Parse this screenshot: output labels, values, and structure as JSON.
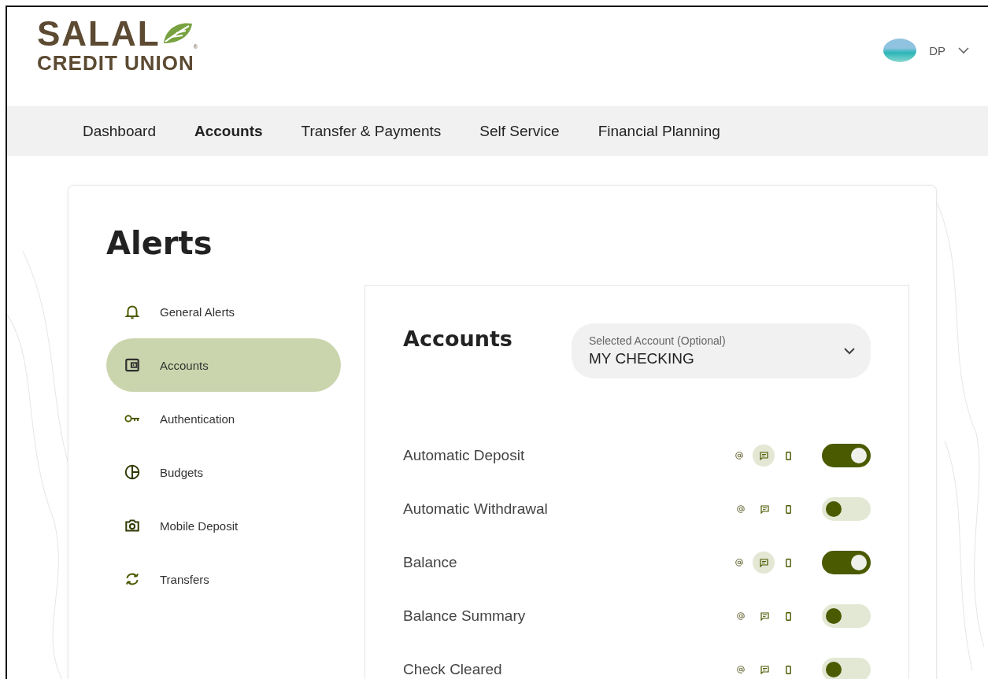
{
  "logo": {
    "name": "SALAL",
    "mark": "®",
    "subtitle": "CREDIT UNION"
  },
  "user": {
    "initials": "DP"
  },
  "nav": [
    {
      "label": "Dashboard",
      "selected": false
    },
    {
      "label": "Accounts",
      "selected": true
    },
    {
      "label": "Transfer & Payments",
      "selected": false
    },
    {
      "label": "Self Service",
      "selected": false
    },
    {
      "label": "Financial Planning",
      "selected": false
    }
  ],
  "page_title": "Alerts",
  "sidebar": {
    "items": [
      {
        "label": "General Alerts",
        "kind": "bell",
        "selected": false
      },
      {
        "label": "Accounts",
        "kind": "wallet",
        "selected": true
      },
      {
        "label": "Authentication",
        "kind": "key",
        "selected": false
      },
      {
        "label": "Budgets",
        "kind": "pie",
        "selected": false
      },
      {
        "label": "Mobile Deposit",
        "kind": "camera",
        "selected": false
      },
      {
        "label": "Transfers",
        "kind": "sync",
        "selected": false
      }
    ]
  },
  "panel": {
    "title": "Accounts",
    "account_select": {
      "label": "Selected Account (Optional)",
      "value": "MY CHECKING"
    },
    "alerts": [
      {
        "name": "Automatic Deposit",
        "on": true,
        "channels": [
          {
            "kind": "email",
            "selected": false
          },
          {
            "kind": "text",
            "selected": true
          },
          {
            "kind": "phone",
            "selected": false
          }
        ]
      },
      {
        "name": "Automatic Withdrawal",
        "on": false,
        "channels": [
          {
            "kind": "email",
            "selected": false
          },
          {
            "kind": "text",
            "selected": false
          },
          {
            "kind": "phone",
            "selected": false
          }
        ]
      },
      {
        "name": "Balance",
        "on": true,
        "channels": [
          {
            "kind": "email",
            "selected": false
          },
          {
            "kind": "text",
            "selected": true
          },
          {
            "kind": "phone",
            "selected": false
          }
        ]
      },
      {
        "name": "Balance Summary",
        "on": false,
        "channels": [
          {
            "kind": "email",
            "selected": false
          },
          {
            "kind": "text",
            "selected": false
          },
          {
            "kind": "phone",
            "selected": false
          }
        ]
      },
      {
        "name": "Check Cleared",
        "on": false,
        "channels": [
          {
            "kind": "email",
            "selected": false
          },
          {
            "kind": "text",
            "selected": false
          },
          {
            "kind": "phone",
            "selected": false
          }
        ]
      }
    ]
  }
}
